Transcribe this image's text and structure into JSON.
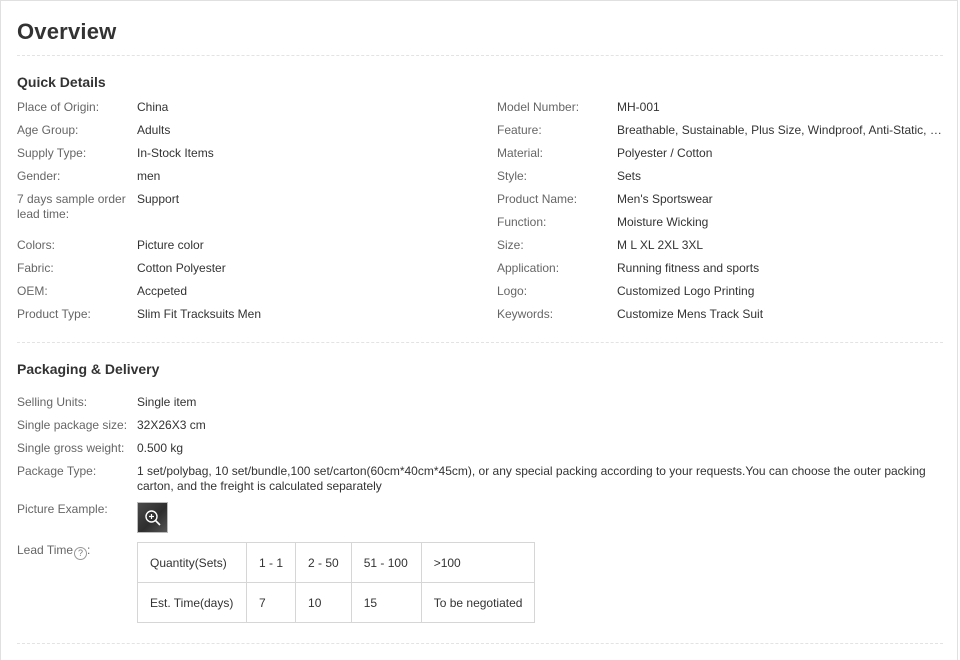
{
  "page_title": "Overview",
  "quick_details": {
    "title": "Quick Details",
    "left": [
      {
        "label": "Place of Origin:",
        "value": "China"
      },
      {
        "label": "Age Group:",
        "value": "Adults"
      },
      {
        "label": "Supply Type:",
        "value": "In-Stock Items"
      },
      {
        "label": "Gender:",
        "value": "men"
      },
      {
        "label": "7 days sample order lead time:",
        "value": "Support"
      },
      {
        "label": "Colors:",
        "value": "Picture color"
      },
      {
        "label": "Fabric:",
        "value": "Cotton Polyester"
      },
      {
        "label": "OEM:",
        "value": "Accpeted"
      },
      {
        "label": "Product Type:",
        "value": "Slim Fit Tracksuits Men"
      }
    ],
    "right": [
      {
        "label": "Model Number:",
        "value": "MH-001"
      },
      {
        "label": "Feature:",
        "value": "Breathable, Sustainable, Plus Size, Windproof, Anti-Static, Fo..."
      },
      {
        "label": "Material:",
        "value": "Polyester / Cotton"
      },
      {
        "label": "Style:",
        "value": "Sets"
      },
      {
        "label": "Product Name:",
        "value": "Men's Sportswear"
      },
      {
        "label": "Function:",
        "value": "Moisture Wicking"
      },
      {
        "label": "Size:",
        "value": "M L XL 2XL 3XL"
      },
      {
        "label": "Application:",
        "value": "Running fitness and sports"
      },
      {
        "label": "Logo:",
        "value": "Customized Logo Printing"
      },
      {
        "label": "Keywords:",
        "value": "Customize Mens Track Suit"
      }
    ]
  },
  "packaging": {
    "title": "Packaging & Delivery",
    "rows": [
      {
        "label": "Selling Units:",
        "value": "Single item"
      },
      {
        "label": "Single package size:",
        "value": "32X26X3 cm"
      },
      {
        "label": "Single gross weight:",
        "value": "0.500 kg"
      },
      {
        "label": "Package Type:",
        "value": "1 set/polybag, 10 set/bundle,100 set/carton(60cm*40cm*45cm), or any special packing according to your requests.You can choose the outer packing carton, and the freight is calculated separately"
      }
    ],
    "picture_label": "Picture Example:",
    "picture_icon": "zoom-in-icon",
    "lead_time_label": "Lead Time",
    "lead_time_help": "?",
    "lead_time_colon": ":",
    "lead_table": {
      "quantity_row": [
        "Quantity(Sets)",
        "1 - 1",
        "2 - 50",
        "51 - 100",
        ">100"
      ],
      "time_row": [
        "Est. Time(days)",
        "7",
        "10",
        "15",
        "To be negotiated"
      ]
    }
  }
}
